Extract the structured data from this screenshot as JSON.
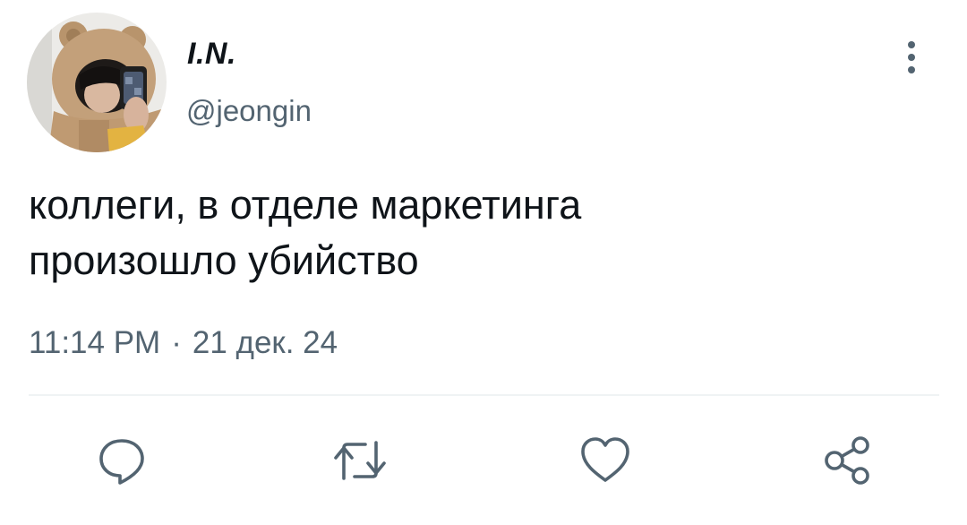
{
  "author": {
    "display_name": "I.N.",
    "handle": "@jeongin",
    "avatar_icon": "avatar-photo"
  },
  "tweet": {
    "text": "коллеги, в отделе маркетинга\nпроизошло убийство",
    "time": "11:14 PM",
    "separator": "·",
    "date": "21 дек. 24"
  },
  "icons": {
    "more": "more-vertical-icon",
    "reply": "reply-icon",
    "retweet": "retweet-icon",
    "like": "heart-icon",
    "share": "share-icon"
  },
  "colors": {
    "text": "#0f1419",
    "secondary": "#536471",
    "divider": "#eff3f4",
    "icon": "#536471"
  }
}
